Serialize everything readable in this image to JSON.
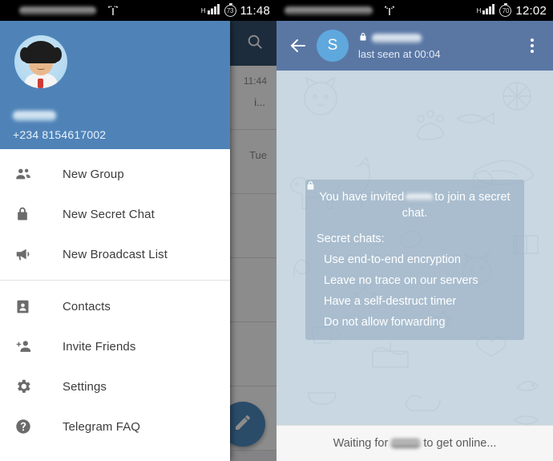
{
  "left": {
    "statusbar": {
      "carrier_blurred": "",
      "network_type": "H",
      "battery": "73",
      "time": "11:48",
      "wifi_icon": "wifi-icon",
      "signal_icon": "signal-bars-icon",
      "battery_icon": "battery-circle-icon"
    },
    "chatlist": {
      "search_icon": "search-icon",
      "row1_time": "11:44",
      "row1_snippet": "i...",
      "row2_day": "Tue",
      "fab_icon": "compose-pencil-icon"
    },
    "drawer": {
      "avatar": "user-avatar",
      "name_blurred": "",
      "phone": "+234 8154617002",
      "items_top": [
        {
          "label": "New Group",
          "icon": "group-icon"
        },
        {
          "label": "New Secret Chat",
          "icon": "lock-icon"
        },
        {
          "label": "New Broadcast List",
          "icon": "megaphone-icon"
        }
      ],
      "items_bottom": [
        {
          "label": "Contacts",
          "icon": "contact-card-icon"
        },
        {
          "label": "Invite Friends",
          "icon": "add-person-icon"
        },
        {
          "label": "Settings",
          "icon": "gear-icon"
        },
        {
          "label": "Telegram FAQ",
          "icon": "help-circle-icon"
        }
      ]
    }
  },
  "right": {
    "statusbar": {
      "carrier_blurred": "",
      "network_type": "H",
      "battery": "70",
      "time": "12:02",
      "wifi_icon": "wifi-icon",
      "signal_icon": "signal-bars-icon",
      "battery_icon": "battery-circle-icon"
    },
    "header": {
      "back_icon": "back-arrow-icon",
      "avatar_initial": "S",
      "secret_lock_icon": "lock-icon",
      "contact_name_blurred": "",
      "status": "last seen at 00:04",
      "menu_icon": "overflow-menu-icon"
    },
    "message": {
      "invite_prefix": "You have invited",
      "invite_suffix": "to join a secret chat.",
      "section_title": "Secret chats:",
      "features": [
        "Use end-to-end encryption",
        "Leave no trace on our servers",
        "Have a self-destruct timer",
        "Do not allow forwarding"
      ],
      "feature_icon": "lock-icon"
    },
    "footer": {
      "prefix": "Waiting for",
      "suffix": "to get online..."
    }
  },
  "colors": {
    "drawer_header_blue": "#4f83b8",
    "chat_actionbar_blue": "#5a77a4",
    "list_actionbar_blue": "#36506e",
    "wallpaper": "#c8d7e1",
    "bubble": "rgba(150,173,193,.62)",
    "fab_blue": "#4d8ac0",
    "avatar_blue": "#5fa8dd"
  }
}
